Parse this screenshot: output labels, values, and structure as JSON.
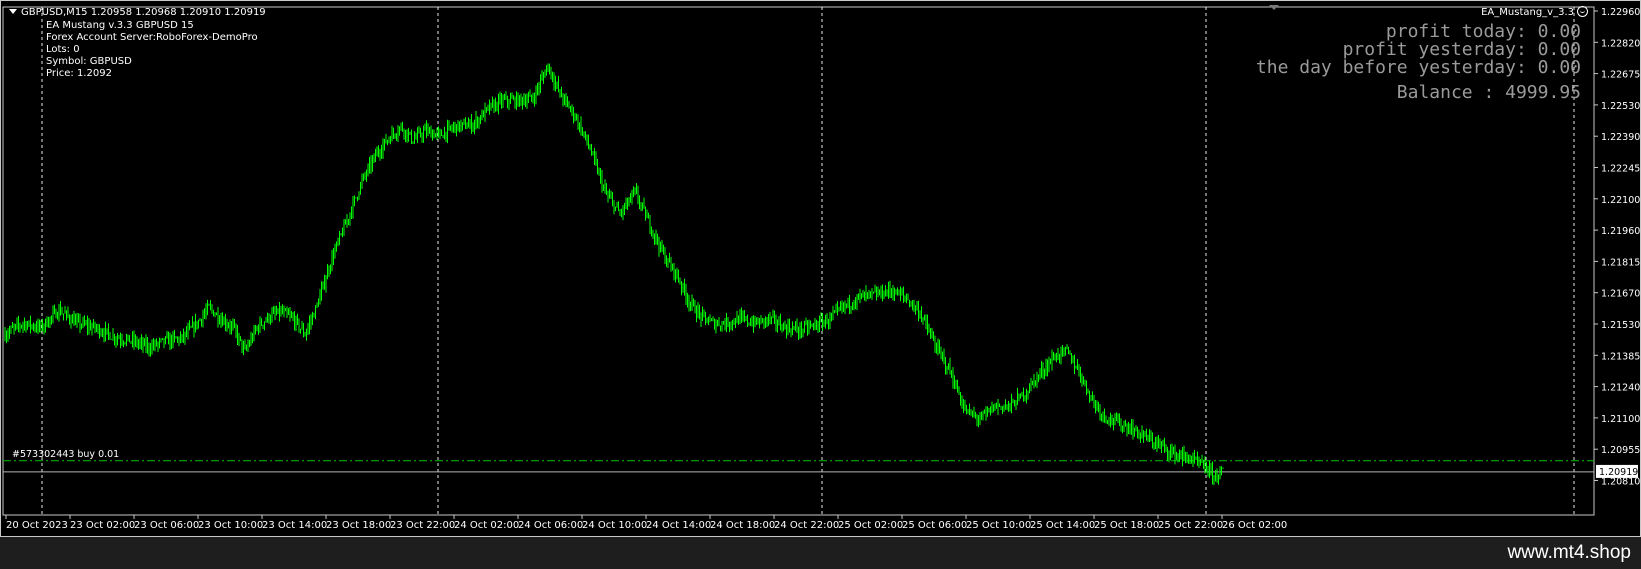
{
  "header": {
    "symbol_line": "GBPUSD,M15  1.20958 1.20968 1.20910 1.20919",
    "ea_line": "EA Mustang v.3.3 GBPUSD  15",
    "server_line": "Forex Account Server:RoboForex-DemoPro",
    "lots_line": "Lots:  0",
    "symbol_info_line": "Symbol: GBPUSD",
    "price_line": "Price:  1.2092",
    "ea_name": "EA_Mustang_v_3.3"
  },
  "profit_panel": {
    "today": "profit today: 0.00",
    "yesterday": "profit yesterday: 0.00",
    "day_before": "the day before yesterday: 0.00",
    "balance": "Balance : 4999.95"
  },
  "order_label": "#573302443 buy 0.01",
  "current_price_label": "1.20919",
  "watermark": "www.mt4.shop",
  "colors": {
    "candle": "#00ff00",
    "bullish_body": "#000000",
    "grid": "#ffffff",
    "order_line": "#00c000",
    "background": "#000000"
  },
  "chart_data": {
    "type": "candlestick",
    "symbol": "GBPUSD",
    "timeframe": "M15",
    "ylim": [
      1.2074,
      1.2303
    ],
    "y_ticks": [
      "1.22960",
      "1.22820",
      "1.22675",
      "1.22530",
      "1.22390",
      "1.22245",
      "1.22100",
      "1.21960",
      "1.21815",
      "1.21670",
      "1.21530",
      "1.21385",
      "1.21240",
      "1.21100",
      "1.20955",
      "1.20810"
    ],
    "x_ticks": [
      "20 Oct 2023",
      "23 Oct 02:00",
      "23 Oct 06:00",
      "23 Oct 10:00",
      "23 Oct 14:00",
      "23 Oct 18:00",
      "23 Oct 22:00",
      "24 Oct 02:00",
      "24 Oct 06:00",
      "24 Oct 10:00",
      "24 Oct 14:00",
      "24 Oct 18:00",
      "24 Oct 22:00",
      "25 Oct 02:00",
      "25 Oct 06:00",
      "25 Oct 10:00",
      "25 Oct 14:00",
      "25 Oct 18:00",
      "25 Oct 22:00",
      "26 Oct 02:00"
    ],
    "day_separators": [
      "20 Oct 2023",
      "23 Oct 22:00",
      "24 Oct 22:00",
      "25 Oct 22:00"
    ],
    "order_price": 1.2097,
    "current_price": 1.20919,
    "close_path": [
      [
        0,
        1.2155
      ],
      [
        12,
        1.216
      ],
      [
        24,
        1.2158
      ],
      [
        36,
        1.2166
      ],
      [
        48,
        1.216
      ],
      [
        60,
        1.2158
      ],
      [
        72,
        1.2154
      ],
      [
        84,
        1.2152
      ],
      [
        96,
        1.2149
      ],
      [
        108,
        1.2152
      ],
      [
        118,
        1.2153
      ],
      [
        128,
        1.216
      ],
      [
        136,
        1.2167
      ],
      [
        144,
        1.2162
      ],
      [
        152,
        1.2158
      ],
      [
        160,
        1.2147
      ],
      [
        168,
        1.2158
      ],
      [
        176,
        1.2163
      ],
      [
        184,
        1.2165
      ],
      [
        192,
        1.2162
      ],
      [
        200,
        1.2155
      ],
      [
        208,
        1.2168
      ],
      [
        218,
        1.219
      ],
      [
        228,
        1.2207
      ],
      [
        238,
        1.2225
      ],
      [
        248,
        1.2238
      ],
      [
        256,
        1.2245
      ],
      [
        264,
        1.225
      ],
      [
        272,
        1.2244
      ],
      [
        280,
        1.2248
      ],
      [
        290,
        1.2246
      ],
      [
        300,
        1.225
      ],
      [
        312,
        1.2251
      ],
      [
        322,
        1.2258
      ],
      [
        332,
        1.2262
      ],
      [
        342,
        1.2262
      ],
      [
        352,
        1.2263
      ],
      [
        362,
        1.2278
      ],
      [
        370,
        1.2265
      ],
      [
        380,
        1.2255
      ],
      [
        390,
        1.224
      ],
      [
        400,
        1.222
      ],
      [
        410,
        1.221
      ],
      [
        420,
        1.222
      ],
      [
        430,
        1.2205
      ],
      [
        440,
        1.219
      ],
      [
        448,
        1.2182
      ],
      [
        456,
        1.217
      ],
      [
        464,
        1.2163
      ],
      [
        472,
        1.216
      ],
      [
        480,
        1.216
      ],
      [
        490,
        1.2162
      ],
      [
        500,
        1.216
      ],
      [
        510,
        1.2162
      ],
      [
        520,
        1.2158
      ],
      [
        530,
        1.2157
      ],
      [
        540,
        1.2159
      ],
      [
        550,
        1.2162
      ],
      [
        560,
        1.2168
      ],
      [
        570,
        1.2172
      ],
      [
        580,
        1.2173
      ],
      [
        590,
        1.2175
      ],
      [
        600,
        1.2172
      ],
      [
        610,
        1.2165
      ],
      [
        620,
        1.215
      ],
      [
        630,
        1.2138
      ],
      [
        640,
        1.212
      ],
      [
        650,
        1.2116
      ],
      [
        660,
        1.2122
      ],
      [
        670,
        1.2122
      ],
      [
        680,
        1.2128
      ],
      [
        690,
        1.2137
      ],
      [
        700,
        1.2145
      ],
      [
        708,
        1.2147
      ],
      [
        716,
        1.2138
      ],
      [
        724,
        1.2126
      ],
      [
        732,
        1.2118
      ],
      [
        740,
        1.2115
      ],
      [
        750,
        1.2112
      ],
      [
        760,
        1.2108
      ],
      [
        770,
        1.2104
      ],
      [
        780,
        1.21
      ],
      [
        790,
        1.2098
      ],
      [
        800,
        1.2094
      ],
      [
        806,
        1.209
      ],
      [
        812,
        1.2092
      ]
    ]
  }
}
